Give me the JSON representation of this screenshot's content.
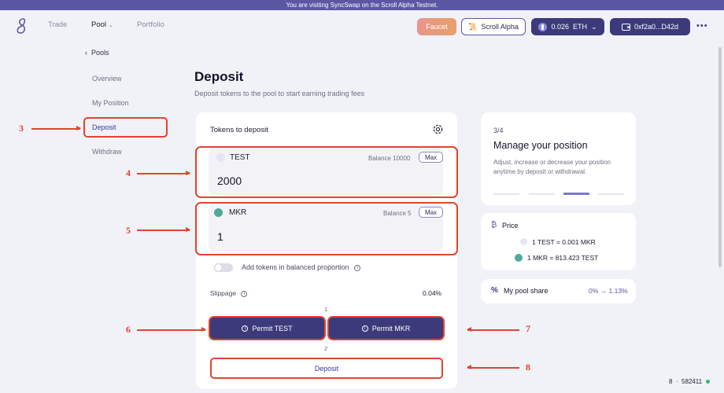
{
  "banner": "You are visiting SyncSwap on the Scroll Alpha Testnet.",
  "nav": {
    "trade": "Trade",
    "pool": "Pool",
    "pool_chevron": "⌄",
    "portfolio": "Portfolio"
  },
  "header": {
    "faucet": "Faucet",
    "network": "Scroll Alpha",
    "balance": "0.026  ETH",
    "balance_chevron": "⌄",
    "wallet": "0xf2a0...D42d",
    "more": "•••"
  },
  "sidebar": {
    "back": "‹  Pools",
    "items": [
      "Overview",
      "My Position",
      "Deposit",
      "Withdraw"
    ]
  },
  "page": {
    "title": "Deposit",
    "subtitle": "Deposit tokens to the pool to start earning trading fees"
  },
  "deposit_card": {
    "title": "Tokens to deposit",
    "tokens": [
      {
        "symbol": "TEST",
        "balance_label": "Balance",
        "balance": "10000",
        "max": "Max",
        "amount": "2000",
        "color": "#b9b6e8"
      },
      {
        "symbol": "MKR",
        "balance_label": "Balance",
        "balance": "5",
        "max": "Max",
        "amount": "1",
        "color": "#4fa89b"
      }
    ],
    "balanced_label": "Add tokens in balanced proportion",
    "slippage_label": "Slippage",
    "slippage_value": "0.04%",
    "step1": "1",
    "step2": "2",
    "permit_test": "Permit TEST",
    "permit_mkr": "Permit MKR",
    "deposit": "Deposit"
  },
  "annotations": [
    "3",
    "4",
    "5",
    "6",
    "7",
    "8"
  ],
  "info_card": {
    "step": "3/4",
    "title": "Manage your position",
    "desc": "Adjust, increase or decrease your position anytime by deposit or withdrawal.",
    "progress_active_index": 2
  },
  "price_card": {
    "icon": "₿",
    "title": "Price",
    "line1": "1 TEST = 0.001 MKR",
    "line2": "1 MKR = 813.423 TEST"
  },
  "share_card": {
    "icon": "%",
    "label": "My pool share",
    "value": "0% → 1.13%"
  },
  "footer": {
    "block": "8  ·  582411"
  },
  "colors": {
    "accent": "#3c3a7a",
    "annotation": "#e0452f",
    "banner": "#5b57a3"
  }
}
